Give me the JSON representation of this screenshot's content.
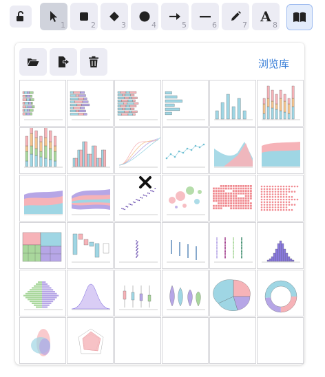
{
  "toolbar": {
    "lock": {
      "icon": "unlock-icon"
    },
    "tools": [
      {
        "name": "selection",
        "icon": "pointer-icon",
        "key": "1",
        "selected": true
      },
      {
        "name": "rectangle",
        "icon": "square-icon",
        "key": "2"
      },
      {
        "name": "diamond",
        "icon": "diamond-icon",
        "key": "3"
      },
      {
        "name": "ellipse",
        "icon": "circle-icon",
        "key": "4"
      },
      {
        "name": "arrow",
        "icon": "arrow-right-icon",
        "key": "5"
      },
      {
        "name": "line",
        "icon": "line-icon",
        "key": "6"
      },
      {
        "name": "draw",
        "icon": "pencil-icon",
        "key": "7"
      },
      {
        "name": "text",
        "icon": "text-icon",
        "label": "A",
        "key": "8"
      }
    ],
    "library": {
      "icon": "book-icon",
      "active": true
    }
  },
  "library_panel": {
    "browse_label": "浏览库",
    "actions": [
      {
        "name": "open",
        "icon": "folder-open-icon"
      },
      {
        "name": "export",
        "icon": "file-export-icon"
      },
      {
        "name": "delete",
        "icon": "trash-icon"
      }
    ],
    "items": [
      {
        "type": "hbar-stacked"
      },
      {
        "type": "hbar-stacked-wide"
      },
      {
        "type": "hbar-stacked-full"
      },
      {
        "type": "hbar-simple"
      },
      {
        "type": "vbar"
      },
      {
        "type": "vbar-stacked"
      },
      {
        "type": "vbar-stacked-tall"
      },
      {
        "type": "vbar-grouped"
      },
      {
        "type": "line-multi"
      },
      {
        "type": "line-dots"
      },
      {
        "type": "area-overlap"
      },
      {
        "type": "area-stacked"
      },
      {
        "type": "area-stacked-2"
      },
      {
        "type": "streamgraph"
      },
      {
        "type": "scatter"
      },
      {
        "type": "bubble"
      },
      {
        "type": "waffle"
      },
      {
        "type": "dot-matrix"
      },
      {
        "type": "treemap"
      },
      {
        "type": "waterfall"
      },
      {
        "type": "strip"
      },
      {
        "type": "strip-2"
      },
      {
        "type": "beeswarm"
      },
      {
        "type": "histogram"
      },
      {
        "type": "pyramid"
      },
      {
        "type": "density"
      },
      {
        "type": "boxplot"
      },
      {
        "type": "violin"
      },
      {
        "type": "pie"
      },
      {
        "type": "donut"
      },
      {
        "type": "radar"
      },
      {
        "type": "radar-2"
      },
      {
        "type": "empty"
      },
      {
        "type": "empty"
      },
      {
        "type": "empty"
      },
      {
        "type": "empty"
      }
    ],
    "hover_delete_icon": "close-x-icon"
  },
  "colors": {
    "accent": "#3a7fd8",
    "pink": "#f6b3b8",
    "blue": "#9fd6e4",
    "purple": "#b6a6e6",
    "green": "#a9d79c",
    "orange": "#f3c38f"
  }
}
